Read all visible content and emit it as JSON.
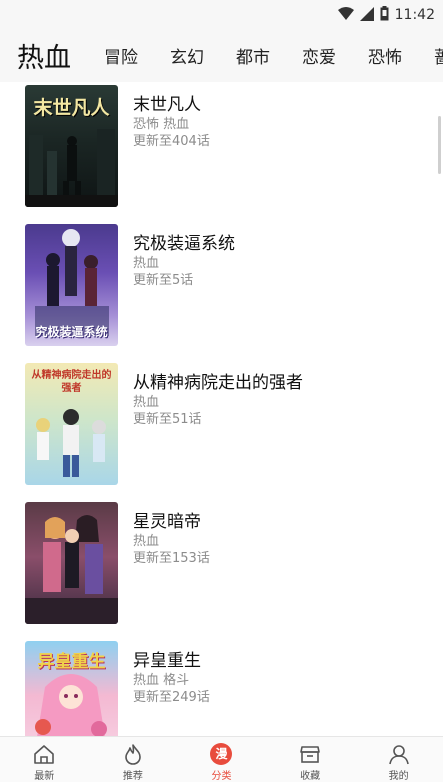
{
  "status": {
    "time": "11:42"
  },
  "header": {
    "current": "热血",
    "tabs": [
      "冒险",
      "玄幻",
      "都市",
      "恋爱",
      "恐怖",
      "蔷薇"
    ]
  },
  "comics": [
    {
      "title": "末世凡人",
      "tags": "恐怖 热血",
      "update": "更新至404话",
      "cover_text": "末世凡人"
    },
    {
      "title": "究极装逼系统",
      "tags": "热血",
      "update": "更新至5话",
      "cover_text": "究极装逼系统"
    },
    {
      "title": "从精神病院走出的强者",
      "tags": "热血",
      "update": "更新至51话",
      "cover_text": "从精神病院走出的强者"
    },
    {
      "title": "星灵暗帝",
      "tags": "热血",
      "update": "更新至153话",
      "cover_text": ""
    },
    {
      "title": "异皇重生",
      "tags": "热血 格斗",
      "update": "更新至249话",
      "cover_text": "异皇重生"
    }
  ],
  "nav": {
    "items": [
      {
        "label": "最新",
        "icon": "home-icon"
      },
      {
        "label": "推荐",
        "icon": "flame-icon"
      },
      {
        "label": "分类",
        "icon": "manga-icon",
        "badge": "漫"
      },
      {
        "label": "收藏",
        "icon": "store-icon"
      },
      {
        "label": "我的",
        "icon": "user-icon"
      }
    ],
    "active_index": 2
  },
  "colors": {
    "accent": "#e84c3d",
    "text_secondary": "#8c8c8c"
  }
}
